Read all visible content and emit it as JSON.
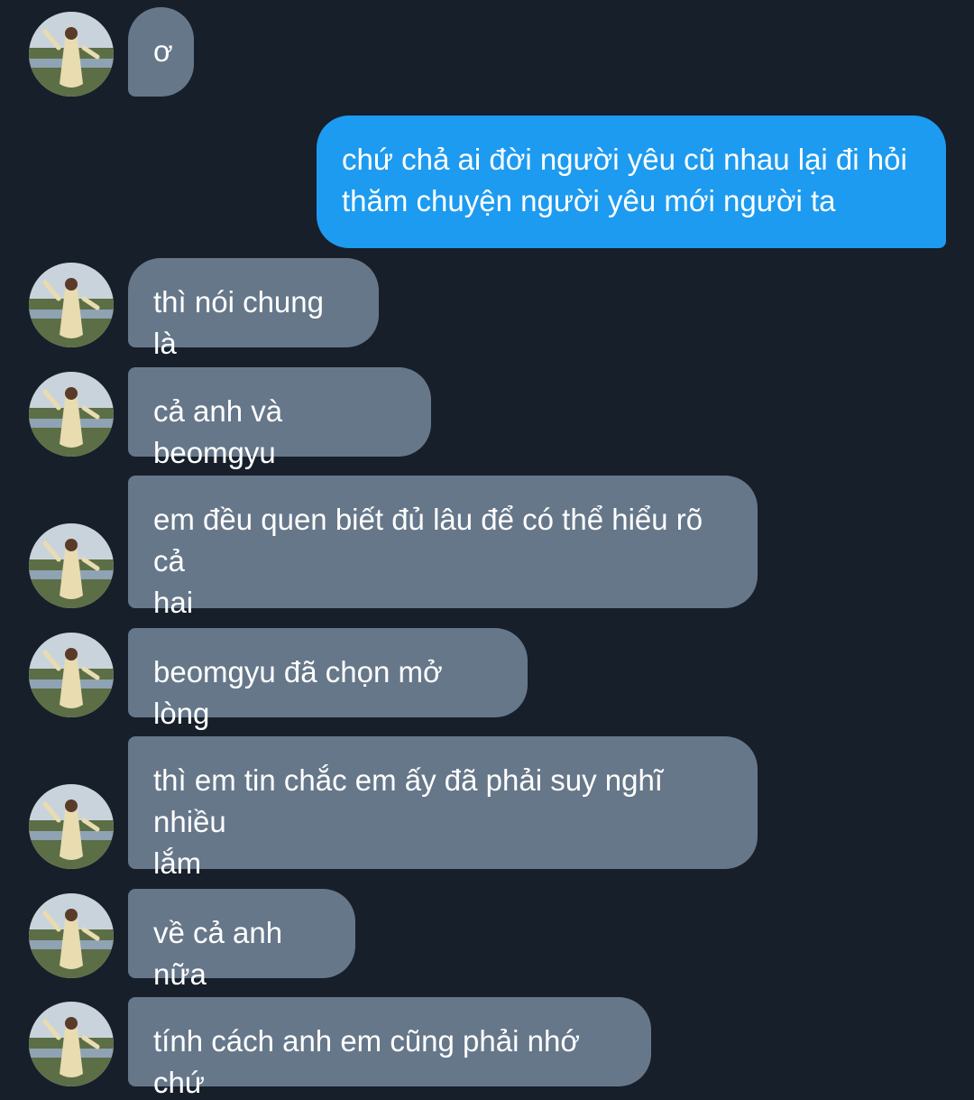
{
  "conversation": {
    "colors": {
      "background": "#161f2a",
      "received_bubble": "#66778a",
      "sent_bubble": "#1d9bf0",
      "text": "#ffffff"
    },
    "messages": [
      {
        "side": "received",
        "text": "ơ",
        "avatar": "contact-avatar"
      },
      {
        "side": "sent",
        "text": "chứ chả ai đời người yêu cũ nhau lại đi hỏi\nthăm chuyện người yêu mới người ta"
      },
      {
        "side": "received",
        "text": "thì nói chung là",
        "avatar": "contact-avatar"
      },
      {
        "side": "received",
        "text": "cả anh và beomgyu",
        "avatar": "contact-avatar"
      },
      {
        "side": "received",
        "text": "em đều quen biết đủ lâu để có thể hiểu rõ cả\nhai",
        "avatar": "contact-avatar"
      },
      {
        "side": "received",
        "text": "beomgyu đã chọn mở lòng",
        "avatar": "contact-avatar"
      },
      {
        "side": "received",
        "text": "thì em tin chắc em ấy đã phải suy nghĩ nhiều\nlắm",
        "avatar": "contact-avatar"
      },
      {
        "side": "received",
        "text": "về cả anh nữa",
        "avatar": "contact-avatar"
      },
      {
        "side": "received",
        "text": "tính cách anh em cũng phải nhớ chứ",
        "avatar": "contact-avatar"
      }
    ]
  }
}
